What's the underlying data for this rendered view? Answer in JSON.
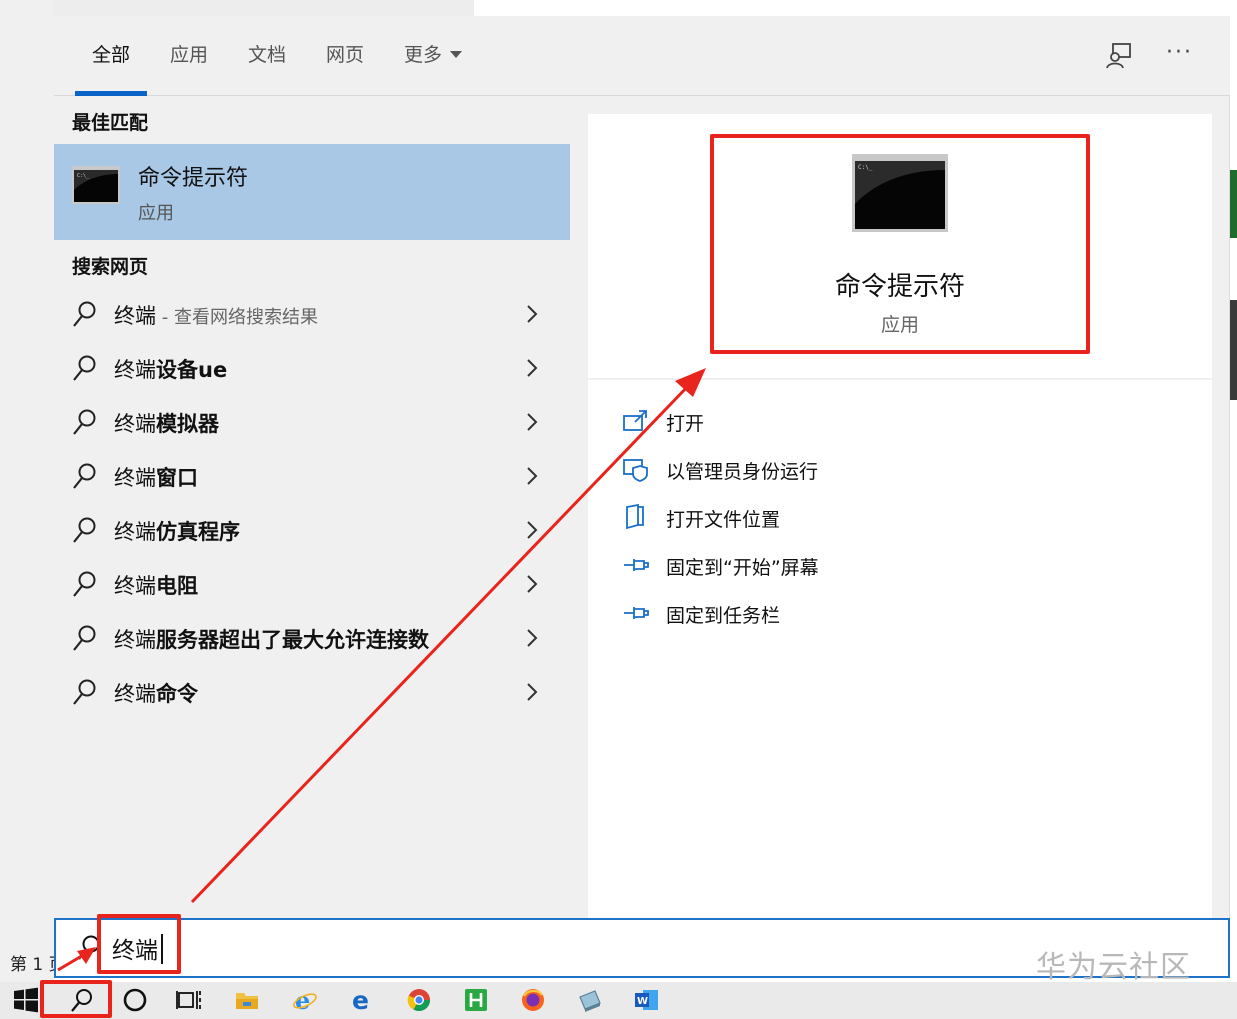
{
  "tabs": [
    {
      "label": "全部"
    },
    {
      "label": "应用"
    },
    {
      "label": "文档"
    },
    {
      "label": "网页"
    },
    {
      "label": "更多"
    }
  ],
  "best_match": {
    "heading": "最佳匹配",
    "title": "命令提示符",
    "subtitle": "应用"
  },
  "web_search": {
    "heading": "搜索网页",
    "items": [
      {
        "query": "终端",
        "bold": "",
        "hint": " - 查看网络搜索结果"
      },
      {
        "query": "终端",
        "bold": "设备ue",
        "hint": ""
      },
      {
        "query": "终端",
        "bold": "模拟器",
        "hint": ""
      },
      {
        "query": "终端",
        "bold": "窗口",
        "hint": ""
      },
      {
        "query": "终端",
        "bold": "仿真程序",
        "hint": ""
      },
      {
        "query": "终端",
        "bold": "电阻",
        "hint": ""
      },
      {
        "query": "终端",
        "bold": "服务器超出了最大允许连接数",
        "hint": ""
      },
      {
        "query": "终端",
        "bold": "命令",
        "hint": ""
      }
    ]
  },
  "preview": {
    "title": "命令提示符",
    "subtitle": "应用",
    "actions": [
      {
        "label": "打开",
        "icon": "open-icon"
      },
      {
        "label": "以管理员身份运行",
        "icon": "shield-icon"
      },
      {
        "label": "打开文件位置",
        "icon": "file-location-icon"
      },
      {
        "label": "固定到“开始”屏幕",
        "icon": "pin-icon"
      },
      {
        "label": "固定到任务栏",
        "icon": "pin-icon"
      }
    ]
  },
  "search_box": {
    "value": "终端",
    "watermark": "华为云社区"
  },
  "background": {
    "page_label": "第 1 页"
  },
  "taskbar": {
    "items": [
      "start-icon",
      "search-icon",
      "cortana-icon",
      "task-view-icon",
      "file-explorer-icon",
      "ie-icon",
      "edge-icon",
      "chrome-icon",
      "hbuilder-icon",
      "firefox-icon",
      "app-icon",
      "word-icon"
    ]
  },
  "colors": {
    "accent": "#0a64c8",
    "selection": "#a8c8e6",
    "annotation": "#e8241c"
  }
}
